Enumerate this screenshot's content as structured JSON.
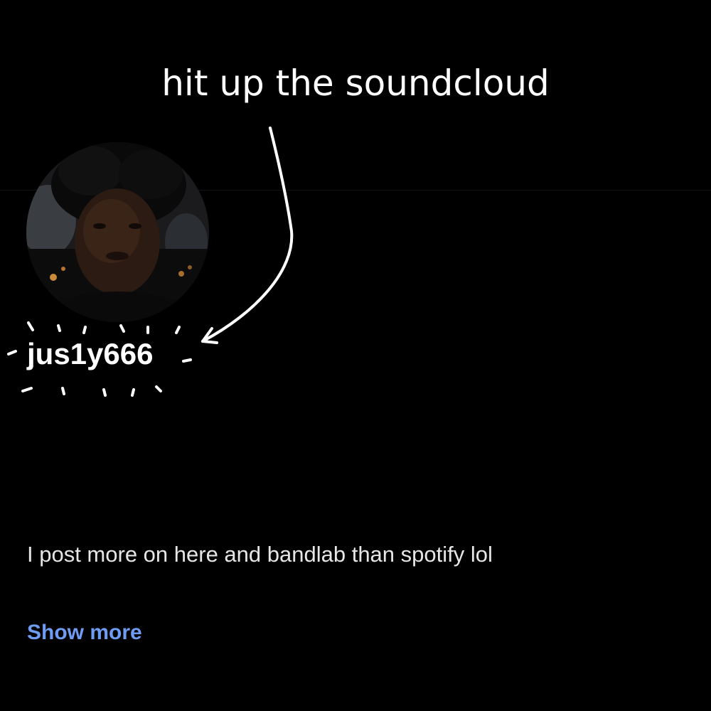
{
  "annotation": {
    "text": "hit up the soundcloud"
  },
  "profile": {
    "username": "jus1y666",
    "avatar_icon": "profile-photo",
    "bio": "I post more on here and bandlab than spotify lol",
    "show_more_label": "Show more"
  },
  "colors": {
    "background": "#000000",
    "link": "#6f9cf3",
    "text": "#ffffff"
  }
}
